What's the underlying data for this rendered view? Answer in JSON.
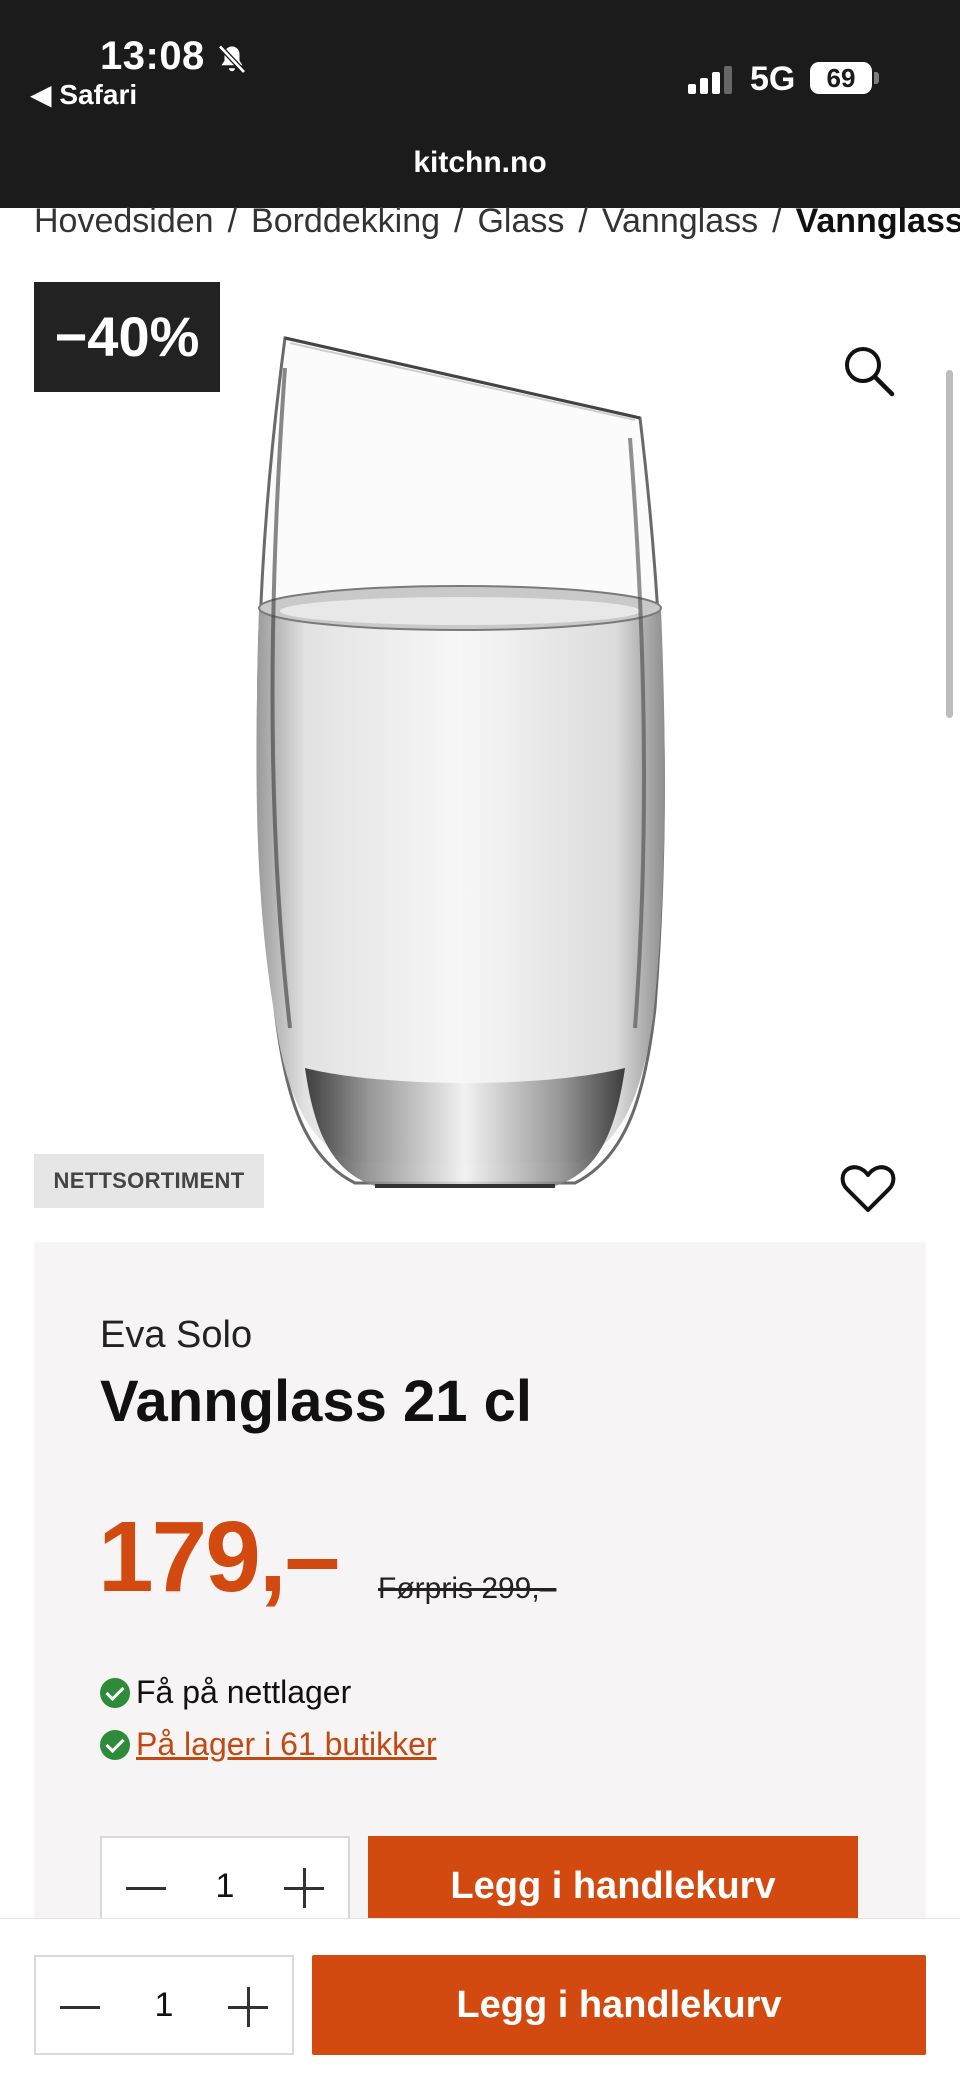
{
  "status_bar": {
    "time": "13:08",
    "back_label": "◀ Safari",
    "network": "5G",
    "battery": "69",
    "url": "kitchn.no"
  },
  "breadcrumb": {
    "items": [
      "Hovedsiden",
      "Borddekking",
      "Glass",
      "Vannglass"
    ],
    "separator": "/",
    "current": "Vannglass"
  },
  "product_media": {
    "discount_badge": "−40%",
    "tag": "NETTSORTIMENT",
    "zoom_icon": "search-icon",
    "favorite_icon": "heart-icon"
  },
  "product": {
    "brand": "Eva Solo",
    "title": "Vannglass 21 cl",
    "price": "179,–",
    "old_price": "Førpris 299,–",
    "stock_online": "Få på nettlager",
    "stock_stores": " På lager i 61 butikker"
  },
  "cart": {
    "quantity": "1",
    "add_label": "Legg i handlekurv"
  },
  "sticky_cart": {
    "quantity": "1",
    "add_label": "Legg i handlekurv"
  },
  "colors": {
    "accent": "#d24a10",
    "status_bar": "#1b1b1b",
    "card_bg": "#f6f4f4",
    "in_stock": "#2e8b3a"
  }
}
